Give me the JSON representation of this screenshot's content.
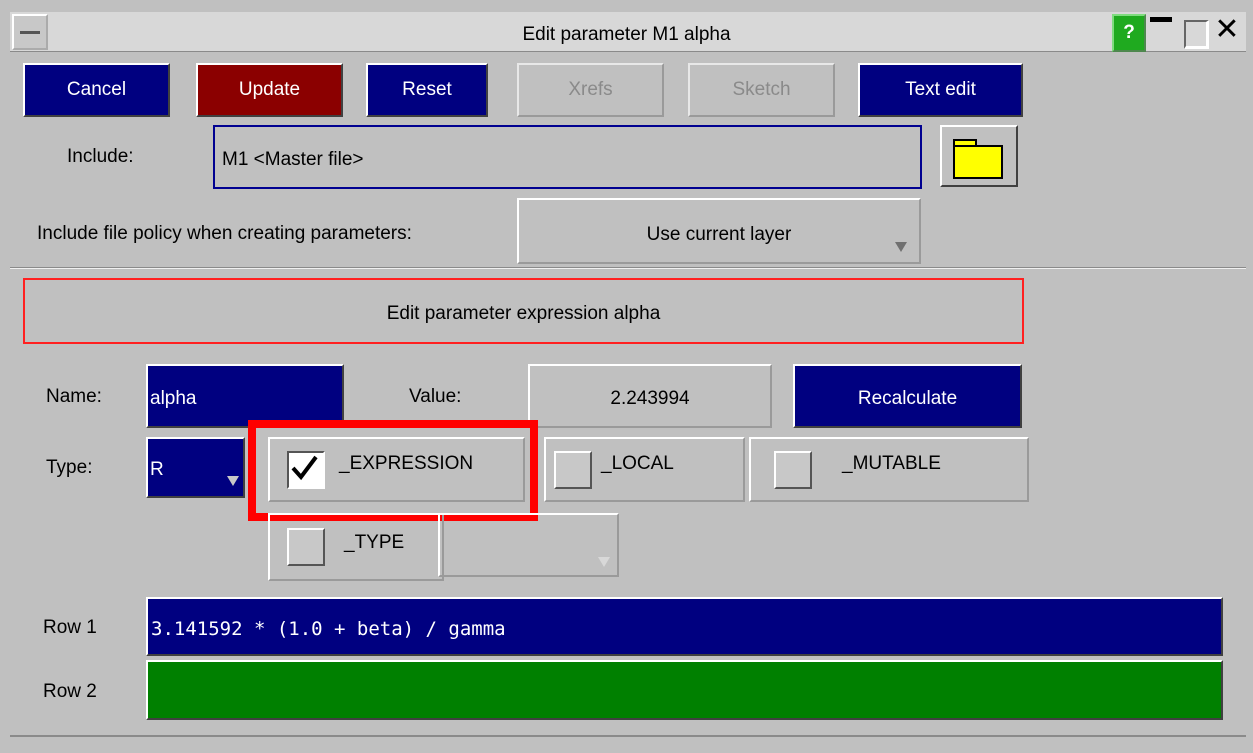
{
  "window": {
    "title": "Edit parameter M1 alpha",
    "help_label": "?"
  },
  "toolbar": {
    "cancel_label": "Cancel",
    "update_label": "Update",
    "reset_label": "Reset",
    "xrefs_label": "Xrefs",
    "sketch_label": "Sketch",
    "text_edit_label": "Text edit"
  },
  "include": {
    "label": "Include:",
    "value": "M1  <Master file>"
  },
  "policy": {
    "label": "Include file policy when creating parameters:",
    "value": "Use current layer"
  },
  "banner": {
    "text": "Edit parameter expression alpha"
  },
  "parameter": {
    "name_label": "Name:",
    "name_value": "alpha",
    "value_label": "Value:",
    "value": "2.243994",
    "recalculate_label": "Recalculate",
    "type_label": "Type:",
    "type_value": "R"
  },
  "options": {
    "expression_label": "_EXPRESSION",
    "expression_checked": true,
    "local_label": "_LOCAL",
    "local_checked": false,
    "mutable_label": "_MUTABLE",
    "mutable_checked": false,
    "type_label": "_TYPE",
    "type_checked": false,
    "type_value": ""
  },
  "rows": {
    "row1_label": "Row 1",
    "row1_value": "3.141592 * (1.0 + beta) / gamma",
    "row2_label": "Row 2",
    "row2_value": ""
  },
  "colors": {
    "background": "#c0c0c0",
    "field_blue": "#000080",
    "update_red": "#8b0000",
    "row2_green": "#008000",
    "highlight_red": "#ff0000",
    "help_green": "#1faa1f",
    "folder_yellow": "#ffff00"
  },
  "icons": {
    "system_menu": "system-menu-icon",
    "folder": "folder-icon",
    "checkmark": "checkmark-icon",
    "dropdown": "dropdown-arrow-icon"
  }
}
